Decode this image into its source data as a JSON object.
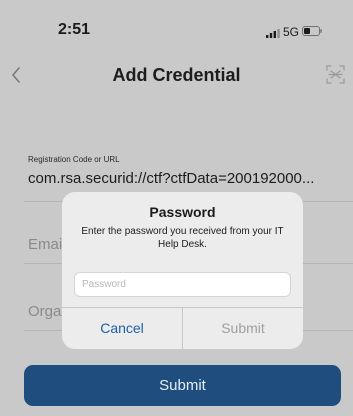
{
  "status_bar": {
    "time": "2:51",
    "network": "5G"
  },
  "nav": {
    "title": "Add Credential",
    "icons": [
      "back-chevron-icon",
      "qr-scan-icon"
    ]
  },
  "form": {
    "registration_label": "Registration Code or URL",
    "registration_value": "com.rsa.securid://ctf?ctfData=200192000...",
    "email_label_partial": "Emai",
    "organization_label_partial": "Orga",
    "submit_label": "Submit"
  },
  "dialog": {
    "title": "Password",
    "message": "Enter the password you received from your IT Help Desk.",
    "password_placeholder": "Password",
    "password_value": "",
    "cancel_label": "Cancel",
    "submit_label": "Submit"
  },
  "colors": {
    "background_dimmed": "#c9c9c9",
    "dialog_background": "#ececec",
    "cancel_blue": "#1f5fa8",
    "submit_disabled": "#9f9f9f",
    "primary_button": "#1e4d7e"
  }
}
